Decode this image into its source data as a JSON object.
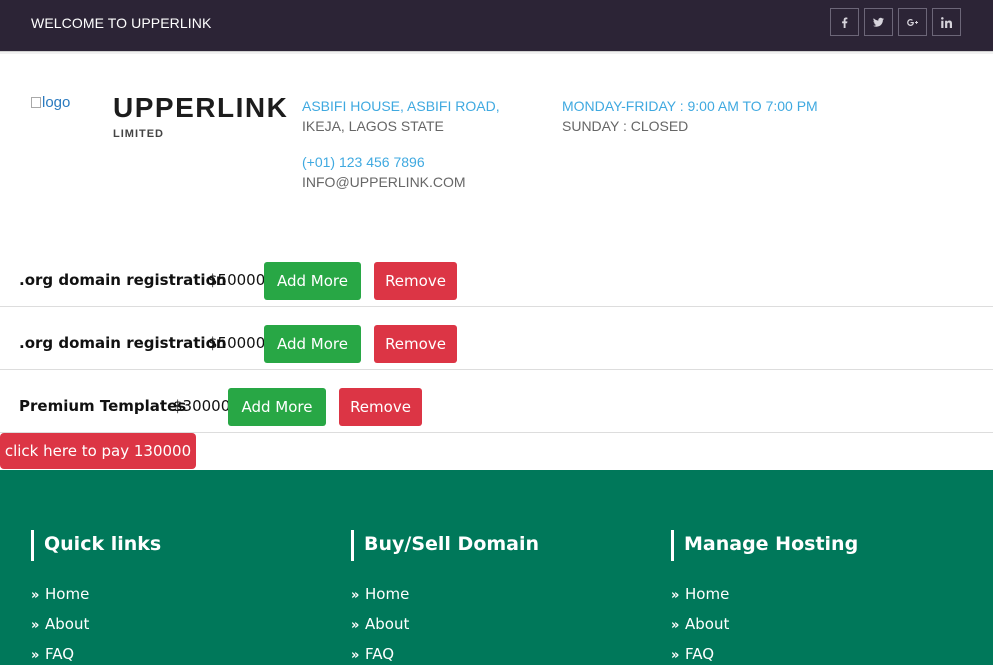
{
  "topbar": {
    "welcome": "WELCOME TO UPPERLINK",
    "social": [
      "facebook-icon",
      "twitter-icon",
      "google-plus-icon",
      "linkedin-icon"
    ]
  },
  "header": {
    "logo_alt": "logo",
    "brand": "UPPERLINK",
    "brand_sub": "LIMITED",
    "address_line1": "ASBIFI HOUSE, ASBIFI ROAD,",
    "address_line2": "IKEJA, LAGOS STATE",
    "phone": "(+01) 123 456 7896",
    "email": "INFO@UPPERLINK.COM",
    "hours_weekday": "MONDAY-FRIDAY : 9:00 AM TO 7:00 PM",
    "hours_sunday": "SUNDAY : CLOSED"
  },
  "cart": {
    "items": [
      {
        "name": ".org domain registration",
        "price": "$50000"
      },
      {
        "name": ".org domain registration",
        "price": "$50000"
      },
      {
        "name": "Premium Templates",
        "price": "$30000"
      }
    ],
    "add_label": "Add More",
    "remove_label": "Remove",
    "pay_label": "click here to pay 130000"
  },
  "footer": {
    "columns": [
      {
        "title": "Quick links",
        "links": [
          "Home",
          "About",
          "FAQ"
        ]
      },
      {
        "title": "Buy/Sell Domain",
        "links": [
          "Home",
          "About",
          "FAQ"
        ]
      },
      {
        "title": "Manage Hosting",
        "links": [
          "Home",
          "About",
          "FAQ"
        ]
      }
    ]
  },
  "colors": {
    "topbar_bg": "#2c2436",
    "accent_blue": "#3fa9e0",
    "success": "#28a745",
    "danger": "#dc3545",
    "footer_bg": "#00785a"
  }
}
